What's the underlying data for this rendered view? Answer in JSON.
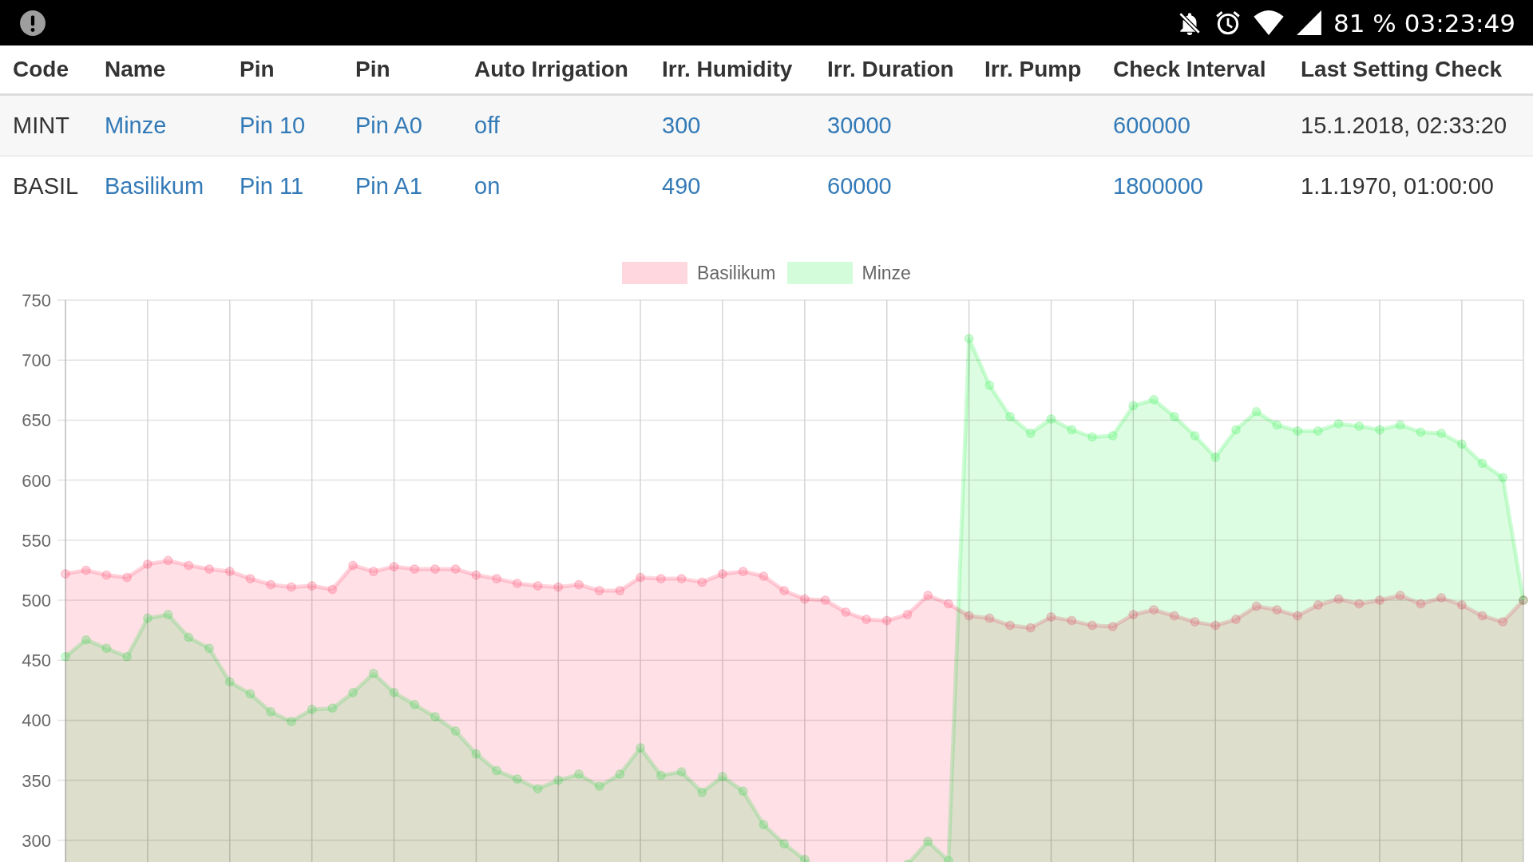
{
  "status_bar": {
    "battery": "81 %",
    "time": "03:23:49"
  },
  "table": {
    "columns": [
      "Code",
      "Name",
      "Pin",
      "Pin",
      "Auto Irrigation",
      "Irr. Humidity",
      "Irr. Duration",
      "Irr. Pump",
      "Check Interval",
      "Last Setting Check"
    ],
    "rows": [
      {
        "cells": [
          {
            "kind": "text",
            "text": "MINT"
          },
          {
            "kind": "link",
            "text": "Minze"
          },
          {
            "kind": "link",
            "text": "Pin 10"
          },
          {
            "kind": "link",
            "text": "Pin A0"
          },
          {
            "kind": "link",
            "text": "off"
          },
          {
            "kind": "link",
            "text": "300"
          },
          {
            "kind": "link",
            "text": "30000"
          },
          {
            "kind": "blank"
          },
          {
            "kind": "link",
            "text": "600000"
          },
          {
            "kind": "text",
            "text": "15.1.2018, 02:33:20"
          }
        ]
      },
      {
        "cells": [
          {
            "kind": "text",
            "text": "BASIL"
          },
          {
            "kind": "link",
            "text": "Basilikum"
          },
          {
            "kind": "link",
            "text": "Pin 11"
          },
          {
            "kind": "link",
            "text": "Pin A1"
          },
          {
            "kind": "link",
            "text": "on"
          },
          {
            "kind": "link",
            "text": "490"
          },
          {
            "kind": "link",
            "text": "60000"
          },
          {
            "kind": "blank"
          },
          {
            "kind": "link",
            "text": "1800000"
          },
          {
            "kind": "text",
            "text": "1.1.1970, 01:00:00"
          }
        ]
      }
    ]
  },
  "chart": {
    "chart_data": {
      "type": "area",
      "grid": true,
      "ylim": [
        250,
        750
      ],
      "yticks": [
        300,
        350,
        400,
        450,
        500,
        550,
        600,
        650,
        700,
        750
      ],
      "series": [
        {
          "name": "Basilikum",
          "color": "#ff6384",
          "values": [
            522,
            525,
            521,
            519,
            530,
            533,
            529,
            526,
            524,
            518,
            513,
            511,
            512,
            509,
            529,
            524,
            528,
            526,
            526,
            526,
            521,
            518,
            514,
            512,
            511,
            513,
            508,
            508,
            519,
            518,
            518,
            515,
            522,
            524,
            520,
            508,
            501,
            500,
            490,
            484,
            483,
            488,
            504,
            497,
            487,
            485,
            479,
            477,
            486,
            483,
            479,
            478,
            488,
            492,
            487,
            482,
            479,
            484,
            495,
            492,
            487,
            496,
            501,
            497,
            500,
            504,
            497,
            502,
            496,
            487,
            482,
            500
          ]
        },
        {
          "name": "Minze",
          "color": "#55f56e",
          "values": [
            453,
            467,
            460,
            453,
            485,
            488,
            469,
            460,
            432,
            422,
            407,
            399,
            409,
            410,
            423,
            439,
            423,
            413,
            403,
            391,
            372,
            358,
            351,
            343,
            350,
            355,
            345,
            355,
            377,
            354,
            357,
            340,
            353,
            341,
            313,
            297,
            284,
            270,
            262,
            258,
            262,
            280,
            299,
            283,
            718,
            679,
            653,
            639,
            651,
            642,
            636,
            637,
            662,
            667,
            653,
            637,
            619,
            642,
            657,
            646,
            641,
            641,
            647,
            645,
            642,
            646,
            640,
            639,
            630,
            614,
            602,
            500
          ]
        }
      ]
    }
  }
}
